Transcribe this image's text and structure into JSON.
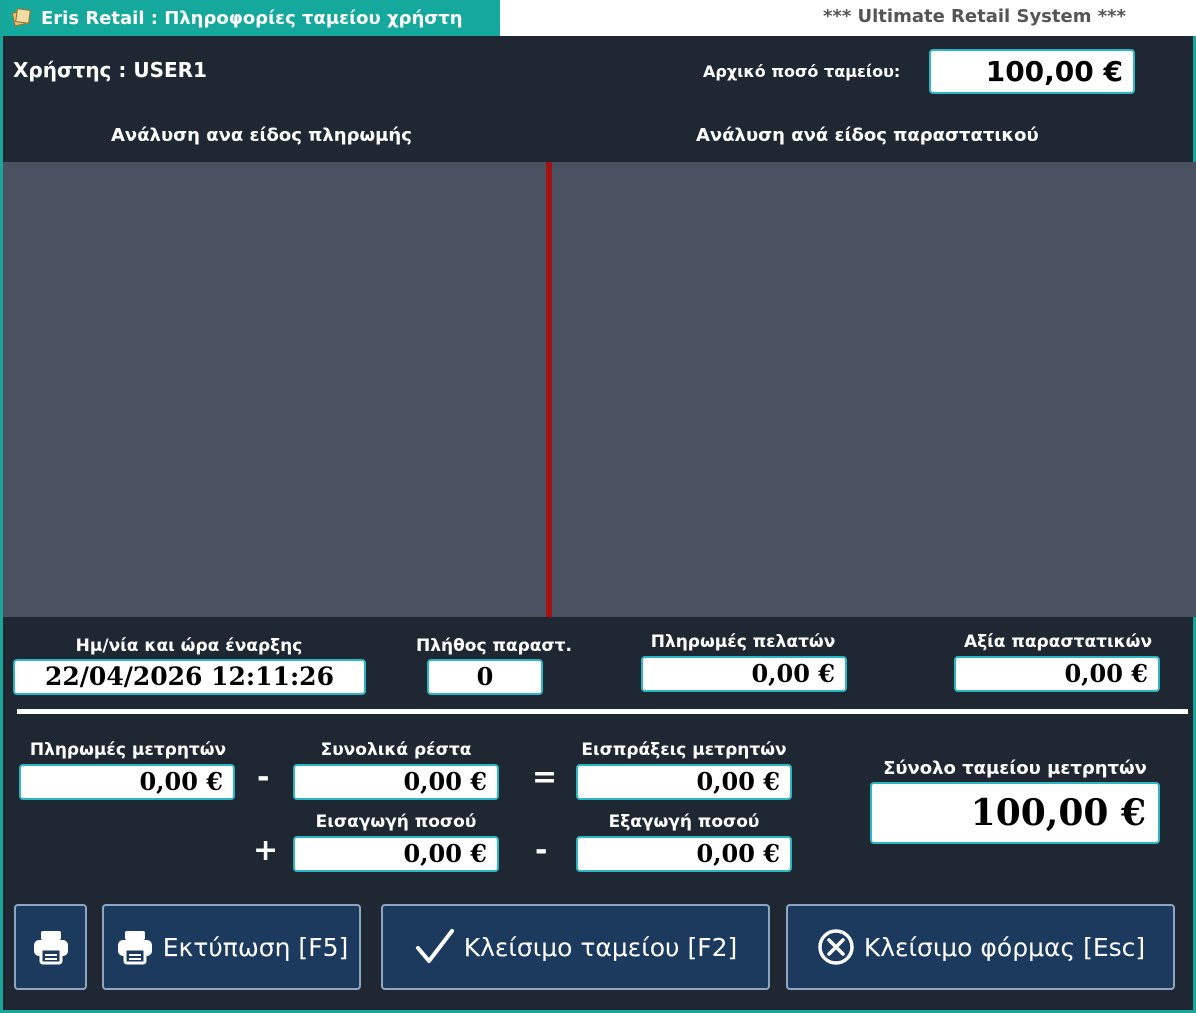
{
  "window": {
    "title": "Eris Retail : Πληροφορίες ταμείου χρήστη",
    "system_banner": "*** Ultimate Retail System ***"
  },
  "user": {
    "label": "Χρήστης :  USER1",
    "initial_amount_label": "Αρχικό ποσό ταμείου:",
    "initial_amount_value": "100,00 €"
  },
  "sections": {
    "payment_breakdown": "Ανάλυση ανα είδος πληρωμής",
    "document_breakdown": "Ανάλυση ανά είδος παραστατικού"
  },
  "summary": {
    "start_label": "Ημ/νία και ώρα έναρξης",
    "start_value": "22/04/2026 12:11:26",
    "doc_count_label": "Πλήθος παραστ.",
    "doc_count_value": "0",
    "customer_payments_label": "Πληρωμές πελατών",
    "customer_payments_value": "0,00 €",
    "documents_value_label": "Αξία παραστατικών",
    "documents_value_value": "0,00 €"
  },
  "cash": {
    "cash_payments_label": "Πληρωμές μετρητών",
    "cash_payments_value": "0,00 €",
    "total_change_label": "Συνολικά ρέστα",
    "total_change_value": "0,00 €",
    "cash_receipts_label": "Εισπράξεις μετρητών",
    "cash_receipts_value": "0,00 €",
    "amount_in_label": "Εισαγωγή ποσού",
    "amount_in_value": "0,00 €",
    "amount_out_label": "Εξαγωγή ποσού",
    "amount_out_value": "0,00 €",
    "cash_total_label": "Σύνολο ταμείου μετρητών",
    "cash_total_value": "100,00 €",
    "op_minus": "-",
    "op_equals": "=",
    "op_plus": "+"
  },
  "buttons": {
    "print_label": "Εκτύπωση [F5]",
    "close_register_label": "Κλείσιμο ταμείου [F2]",
    "close_form_label": "Κλείσιμο φόρμας [Esc]"
  },
  "icons": {
    "app": "receipt-icon",
    "print": "printer-icon",
    "check": "check-icon",
    "close": "close-circle-icon"
  },
  "colors": {
    "background": "#1f2733",
    "accent": "#15a89c",
    "panel": "#4a5160",
    "divider": "#a11212",
    "button": "#1b3a5e"
  }
}
